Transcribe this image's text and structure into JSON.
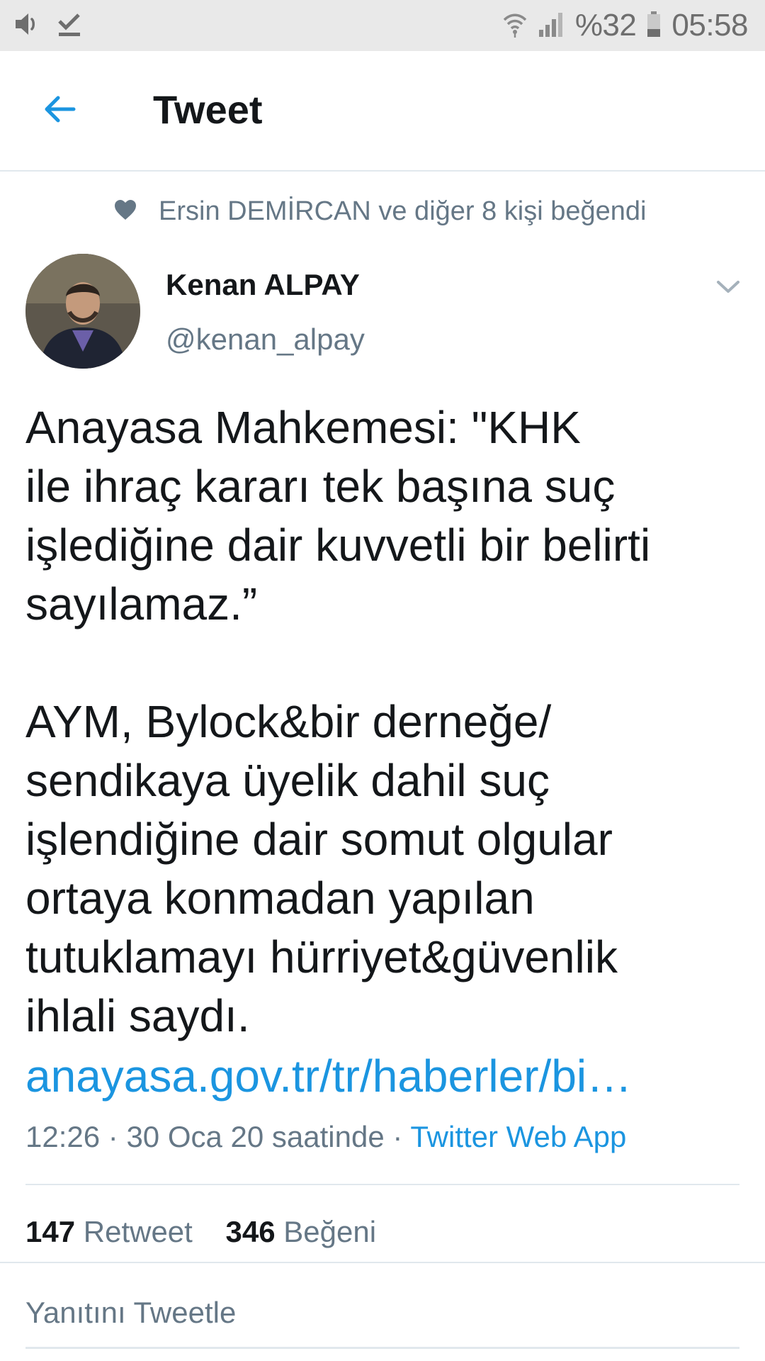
{
  "status_bar": {
    "battery": "%32",
    "time": "05:58",
    "icons": [
      "volume-icon",
      "download-done-icon",
      "wifi-icon",
      "signal-icon",
      "battery-icon"
    ]
  },
  "app_bar": {
    "title": "Tweet",
    "back_icon": "arrow-left-icon"
  },
  "social_context": {
    "text": "Ersin DEMİRCAN ve diğer 8 kişi beğendi",
    "icon": "heart-icon"
  },
  "author": {
    "name": "Kenan ALPAY",
    "handle": "@kenan_alpay"
  },
  "tweet": {
    "text": "Anayasa Mahkemesi: \"KHK\nile ihraç kararı tek başına suç\nişlediğine dair kuvvetli bir belirti\nsayılamaz.”\n\nAYM, Bylock&bir derneğe/\nsendikaya üyelik dahil suç\nişlendiğine dair somut olgular\nortaya konmadan yapılan\ntutuklamayı hürriyet&güvenlik\nihlali saydı.",
    "link": "anayasa.gov.tr/tr/haberler/bi…",
    "time": "12:26",
    "date": "30 Oca 20 saatinde",
    "source": "Twitter Web App",
    "separator": "·"
  },
  "stats": {
    "retweets_count": "147",
    "retweets_label": "Retweet",
    "likes_count": "346",
    "likes_label": "Beğeni"
  },
  "reply": {
    "placeholder": "Yanıtını Tweetle"
  },
  "colors": {
    "accent": "#1b95e0",
    "secondary_text": "#657786",
    "primary_text": "#14171a",
    "status_bar_bg": "#e9e9e9"
  }
}
